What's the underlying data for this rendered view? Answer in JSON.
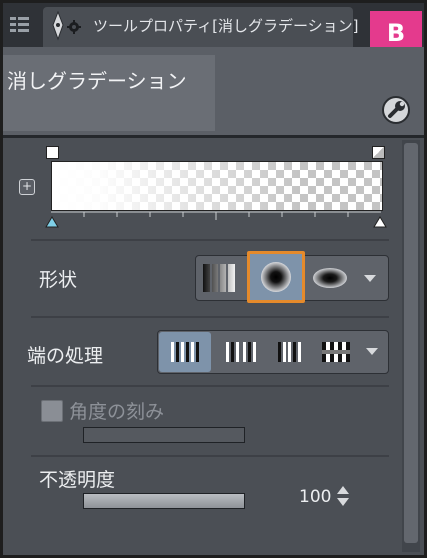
{
  "tab": {
    "title": "ツールプロパティ[消しグラデーション]"
  },
  "badge": {
    "label": "B"
  },
  "preset": {
    "label": "消しグラデーション"
  },
  "gradient": {
    "add_label": "+"
  },
  "shape": {
    "label": "形状",
    "options": [
      "linear-icon",
      "circle-icon",
      "ellipse-icon"
    ],
    "selected": "circle-icon"
  },
  "edge": {
    "label": "端の処理",
    "options": [
      "edge-repeat-icon",
      "edge-reverse-icon",
      "edge-clamp-icon",
      "edge-none-icon"
    ],
    "selected": "edge-repeat-icon"
  },
  "angle": {
    "label": "角度の刻み",
    "enabled": false
  },
  "opacity": {
    "label": "不透明度",
    "value": "100",
    "fraction": 1.0
  },
  "colors": {
    "accent": "#e58a2b",
    "badge": "#e43a8d",
    "selected_bg": "#7e93aa"
  }
}
